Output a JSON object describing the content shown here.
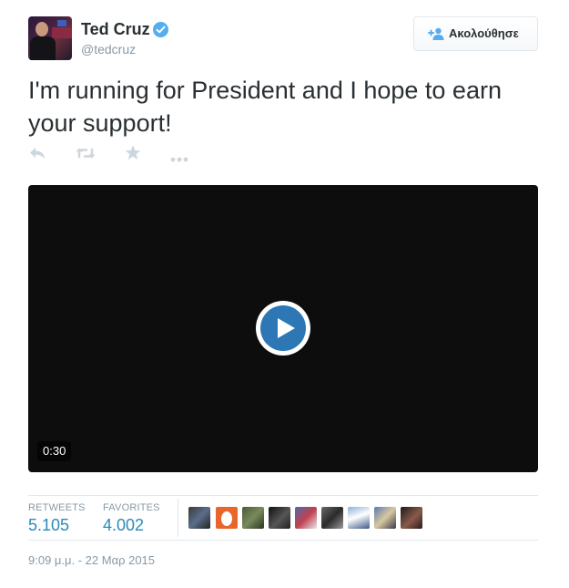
{
  "user": {
    "name": "Ted Cruz",
    "handle": "@tedcruz",
    "avatar_icon": "profile-photo",
    "verified_icon": "verified-badge-icon",
    "verified_color": "#55acee"
  },
  "follow_button": {
    "label": "Ακολούθησε",
    "icon": "follow-person-plus-icon",
    "icon_color": "#55acee"
  },
  "tweet": {
    "text": "I'm running for President and I hope to earn your support!"
  },
  "actions": [
    {
      "name": "reply",
      "icon": "reply-icon"
    },
    {
      "name": "retweet",
      "icon": "retweet-icon"
    },
    {
      "name": "favorite",
      "icon": "star-icon"
    },
    {
      "name": "more",
      "icon": "more-dots-icon"
    }
  ],
  "video": {
    "duration": "0:30",
    "play_icon": "play-icon",
    "play_color": "#2d77b5"
  },
  "stats": {
    "retweets_label": "RETWEETS",
    "retweets_value": "5.105",
    "favorites_label": "FAVORITES",
    "favorites_value": "4.002",
    "value_color": "#2a8ab8"
  },
  "favoriters_count_shown": 9,
  "timestamp": "9:09 μ.μ. - 22 Μαρ 2015"
}
